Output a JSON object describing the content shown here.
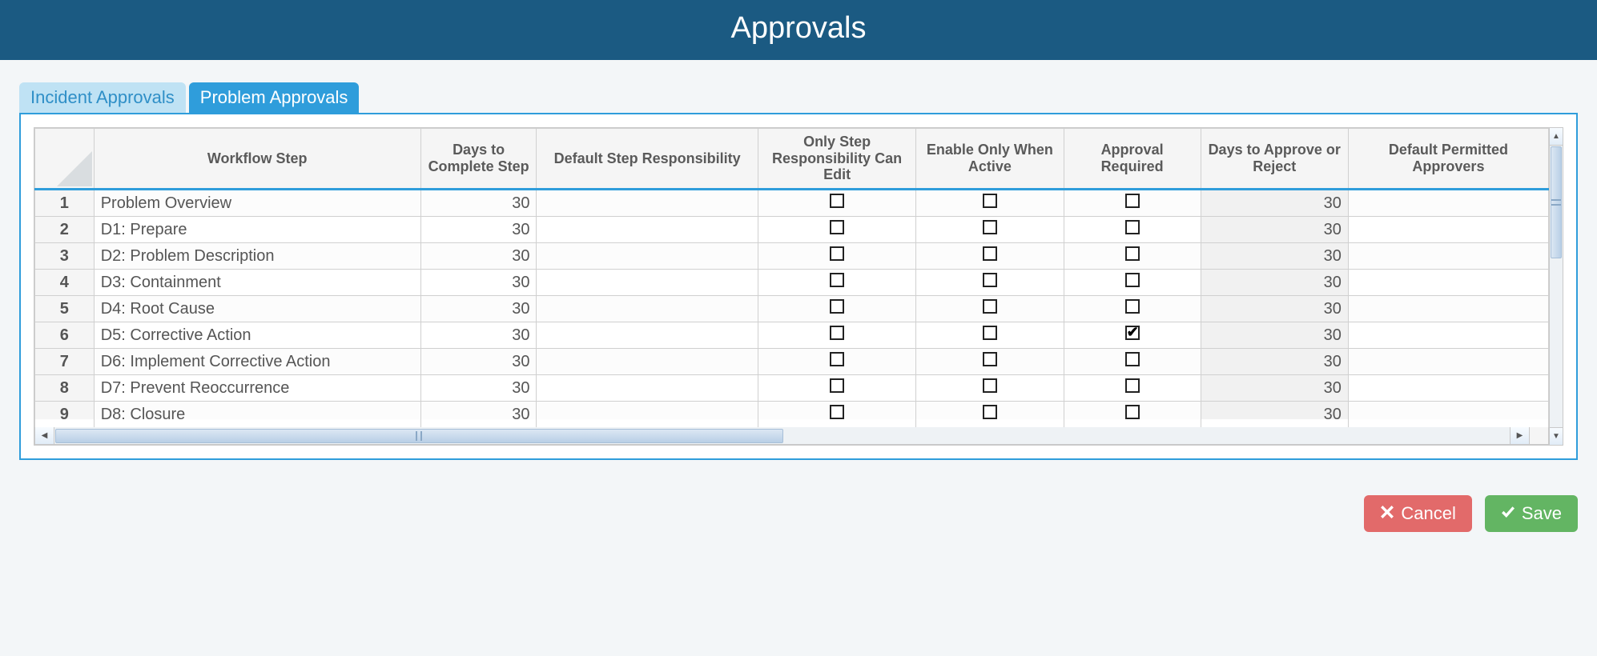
{
  "header": {
    "title": "Approvals"
  },
  "tabs": [
    {
      "label": "Incident Approvals",
      "active": false
    },
    {
      "label": "Problem Approvals",
      "active": true
    }
  ],
  "columns": [
    "Workflow Step",
    "Days to Complete Step",
    "Default Step Responsibility",
    "Only Step Responsibility Can Edit",
    "Enable Only When Active",
    "Approval Required",
    "Days to Approve or Reject",
    "Default Permitted Approvers"
  ],
  "rows": [
    {
      "n": "1",
      "step": "Problem Overview",
      "days_complete": "30",
      "default_resp": "",
      "only_step": false,
      "enable_active": false,
      "approval_req": false,
      "days_approve": "30",
      "approvers": ""
    },
    {
      "n": "2",
      "step": "D1: Prepare",
      "days_complete": "30",
      "default_resp": "",
      "only_step": false,
      "enable_active": false,
      "approval_req": false,
      "days_approve": "30",
      "approvers": ""
    },
    {
      "n": "3",
      "step": "D2: Problem Description",
      "days_complete": "30",
      "default_resp": "",
      "only_step": false,
      "enable_active": false,
      "approval_req": false,
      "days_approve": "30",
      "approvers": ""
    },
    {
      "n": "4",
      "step": "D3: Containment",
      "days_complete": "30",
      "default_resp": "",
      "only_step": false,
      "enable_active": false,
      "approval_req": false,
      "days_approve": "30",
      "approvers": ""
    },
    {
      "n": "5",
      "step": "D4: Root Cause",
      "days_complete": "30",
      "default_resp": "",
      "only_step": false,
      "enable_active": false,
      "approval_req": false,
      "days_approve": "30",
      "approvers": ""
    },
    {
      "n": "6",
      "step": "D5: Corrective Action",
      "days_complete": "30",
      "default_resp": "",
      "only_step": false,
      "enable_active": false,
      "approval_req": true,
      "days_approve": "30",
      "approvers": ""
    },
    {
      "n": "7",
      "step": "D6: Implement Corrective Action",
      "days_complete": "30",
      "default_resp": "",
      "only_step": false,
      "enable_active": false,
      "approval_req": false,
      "days_approve": "30",
      "approvers": ""
    },
    {
      "n": "8",
      "step": "D7: Prevent Reoccurrence",
      "days_complete": "30",
      "default_resp": "",
      "only_step": false,
      "enable_active": false,
      "approval_req": false,
      "days_approve": "30",
      "approvers": ""
    },
    {
      "n": "9",
      "step": "D8: Closure",
      "days_complete": "30",
      "default_resp": "",
      "only_step": false,
      "enable_active": false,
      "approval_req": false,
      "days_approve": "30",
      "approvers": ""
    }
  ],
  "footer": {
    "cancel": "Cancel",
    "save": "Save"
  }
}
